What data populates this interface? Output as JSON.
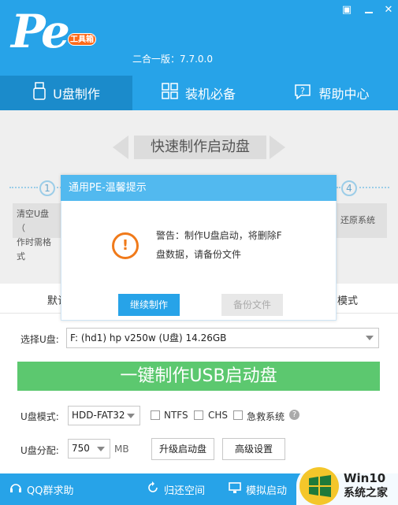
{
  "header": {
    "logo_text": "Pe",
    "logo_badge": "工具箱",
    "version": "二合一版：7.7.0.0",
    "menu_glyph": "▣",
    "close_glyph": "✕"
  },
  "tabs": [
    {
      "label": "U盘制作",
      "icon": "usb-icon"
    },
    {
      "label": "装机必备",
      "icon": "grid-icon"
    },
    {
      "label": "帮助中心",
      "icon": "help-icon"
    }
  ],
  "banner": {
    "title": "快速制作启动盘"
  },
  "steps": {
    "one": "1",
    "four": "4",
    "left_text_1": "清空U盘（",
    "left_text_2": "作时需格式",
    "right_text": "还原系统"
  },
  "subtabs": {
    "left": "默认",
    "right": "模式"
  },
  "form": {
    "select_udisk_label": "选择U盘:",
    "select_udisk_value": "F: (hd1) hp v250w (U盘) 14.26GB",
    "big_button": "一键制作USB启动盘",
    "mode_label": "U盘模式:",
    "mode_value": "HDD-FAT32",
    "ntfs_label": "NTFS",
    "chs_label": "CHS",
    "emergency_label": "急救系统",
    "partition_label": "U盘分配:",
    "partition_value": "750",
    "partition_unit": "MB",
    "upgrade_button": "升级启动盘",
    "advanced_button": "高级设置"
  },
  "footer": {
    "qq": "QQ群求助",
    "restore": "归还空间",
    "simulate": "模拟启动"
  },
  "watermark": {
    "line1": "Win10",
    "line2": "系统之家"
  },
  "dialog": {
    "title": "通用PE-温馨提示",
    "message_line1": "警告：制作U盘启动，将删除F",
    "message_line2": "盘数据，请备份文件",
    "continue_button": "继续制作",
    "backup_button": "备份文件"
  },
  "colors": {
    "primary": "#27a3e8",
    "active_tab": "#1b8bcb",
    "green_button": "#5cc86f",
    "warning": "#f07a1a"
  }
}
